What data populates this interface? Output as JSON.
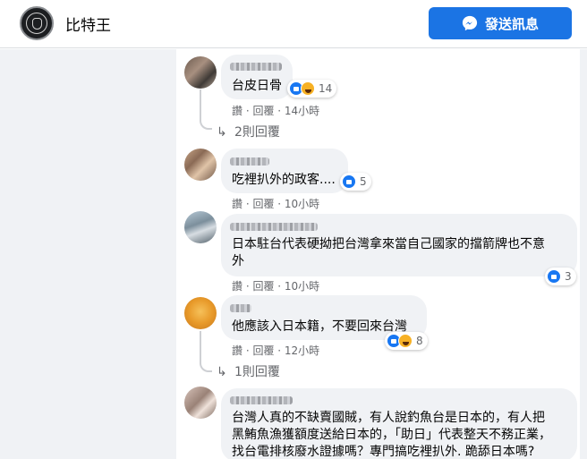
{
  "header": {
    "page_name": "比特王",
    "send_button": "發送訊息"
  },
  "comments": [
    {
      "text": "台皮日骨",
      "react_count": "14",
      "meta": "讚 · 回覆 · 14小時",
      "replies": "2則回覆"
    },
    {
      "text": "吃裡扒外的政客....",
      "react_count": "5",
      "meta": "讚 · 回覆 · 10小時"
    },
    {
      "text_line1": "日本駐台代表硬拗把台灣拿來當自己國家的擋箭牌也不意",
      "text_line2": "外",
      "react_count": "3",
      "meta": "讚 · 回覆 · 10小時"
    },
    {
      "text": "他應該入日本籍，不要回來台灣",
      "react_count": "8",
      "meta": "讚 · 回覆 · 12小時",
      "replies": "1則回覆"
    },
    {
      "text_line1": "台灣人真的不缺賣國賊，有人說釣魚台是日本的，有人把",
      "text_line2": "黑鮪魚漁獲額度送給日本的，「助日」代表整天不務正業，",
      "text_line3": "找台電排核廢水證據嗎？專門搞吃裡扒外. 跪舔日本嗎?"
    }
  ],
  "colors": {
    "accent": "#1b74e4",
    "bubble": "#f0f2f5",
    "meta": "#65676b"
  },
  "icons": [
    "messenger-icon",
    "like-reaction-icon",
    "haha-reaction-icon"
  ]
}
